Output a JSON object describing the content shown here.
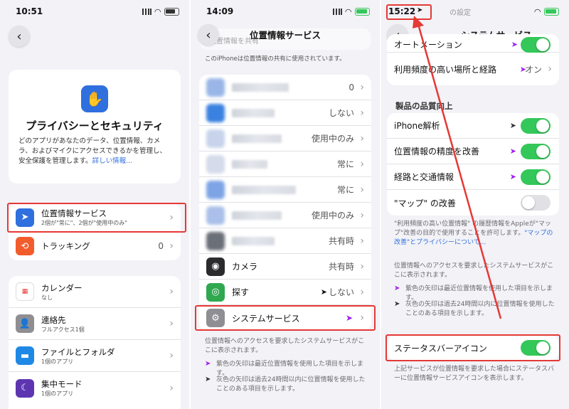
{
  "panel1": {
    "time": "10:51",
    "hero_title": "プライバシーとセキュリティ",
    "hero_desc": "どのアプリがあなたのデータ、位置情報、カメラ、およびマイクにアクセスできるかを管理し、安全保護を管理します。",
    "hero_link": "詳しい情報...",
    "location": {
      "label": "位置情報サービス",
      "sub": "2個が\"常に\"、2個が\"使用中のみ\""
    },
    "tracking": {
      "label": "トラッキング",
      "value": "0"
    },
    "apps": [
      {
        "label": "カレンダー",
        "sub": "なし"
      },
      {
        "label": "連絡先",
        "sub": "フルアクセス1個"
      },
      {
        "label": "ファイルとフォルダ",
        "sub": "1個のアプリ"
      },
      {
        "label": "集中モード",
        "sub": "1個のアプリ"
      }
    ]
  },
  "panel2": {
    "time": "14:09",
    "title": "位置情報サービス",
    "top_row_text": "位置情報を共有",
    "share_note": "このiPhoneは位置情報の共有に使用されています。",
    "blurred_rows": [
      {
        "value": "0"
      },
      {
        "value": "しない"
      },
      {
        "value": "使用中のみ"
      },
      {
        "value": "常に"
      },
      {
        "value": "常に"
      },
      {
        "value": "使用中のみ"
      },
      {
        "value": "共有時"
      }
    ],
    "camera": {
      "label": "カメラ",
      "value": "共有時"
    },
    "find": {
      "label": "探す",
      "value": "しない"
    },
    "system": {
      "label": "システムサービス"
    },
    "note_main": "位置情報へのアクセスを要求したシステムサービスがここに表示されます。",
    "note_purple": "紫色の矢印は最近位置情報を使用した項目を示します。",
    "note_gray": "灰色の矢印は過去24時間以内に位置情報を使用したことのある項目を示します。"
  },
  "panel3": {
    "time": "15:22",
    "title": "システムサービス",
    "top_partial": "の設定",
    "automation": "オートメーション",
    "frequent": {
      "label": "利用頻度の高い場所と経路",
      "value": "オン"
    },
    "quality_header": "製品の品質向上",
    "quality_rows": [
      {
        "label": "iPhone解析",
        "on": true
      },
      {
        "label": "位置情報の精度を改善",
        "on": true
      },
      {
        "label": "経路と交通情報",
        "on": true
      },
      {
        "label": "\"マップ\" の改善",
        "on": false
      }
    ],
    "maps_note": "\"利用頻度の高い位置情報\" の履歴情報をAppleが\"マップ\"改善の目的で使用することを許可します。",
    "maps_link": "\"マップの改善\"とプライバシーについて...",
    "note_main": "位置情報へのアクセスを要求したシステムサービスがここに表示されます。",
    "note_purple": "紫色の矢印は最近位置情報を使用した項目を示します。",
    "note_gray": "灰色の矢印は過去24時間以内に位置情報を使用したことのある項目を示します。",
    "statusbar_icon": {
      "label": "ステータスバーアイコン",
      "on": true
    },
    "statusbar_note": "上記サービスが位置情報を要求した場合にステータスバーに位置情報サービスアイコンを表示します。"
  },
  "colors": {
    "accent": "#2f6fde",
    "toggle_on": "#34c759",
    "highlight": "#e53935",
    "purple_arrow": "#a020f0"
  }
}
